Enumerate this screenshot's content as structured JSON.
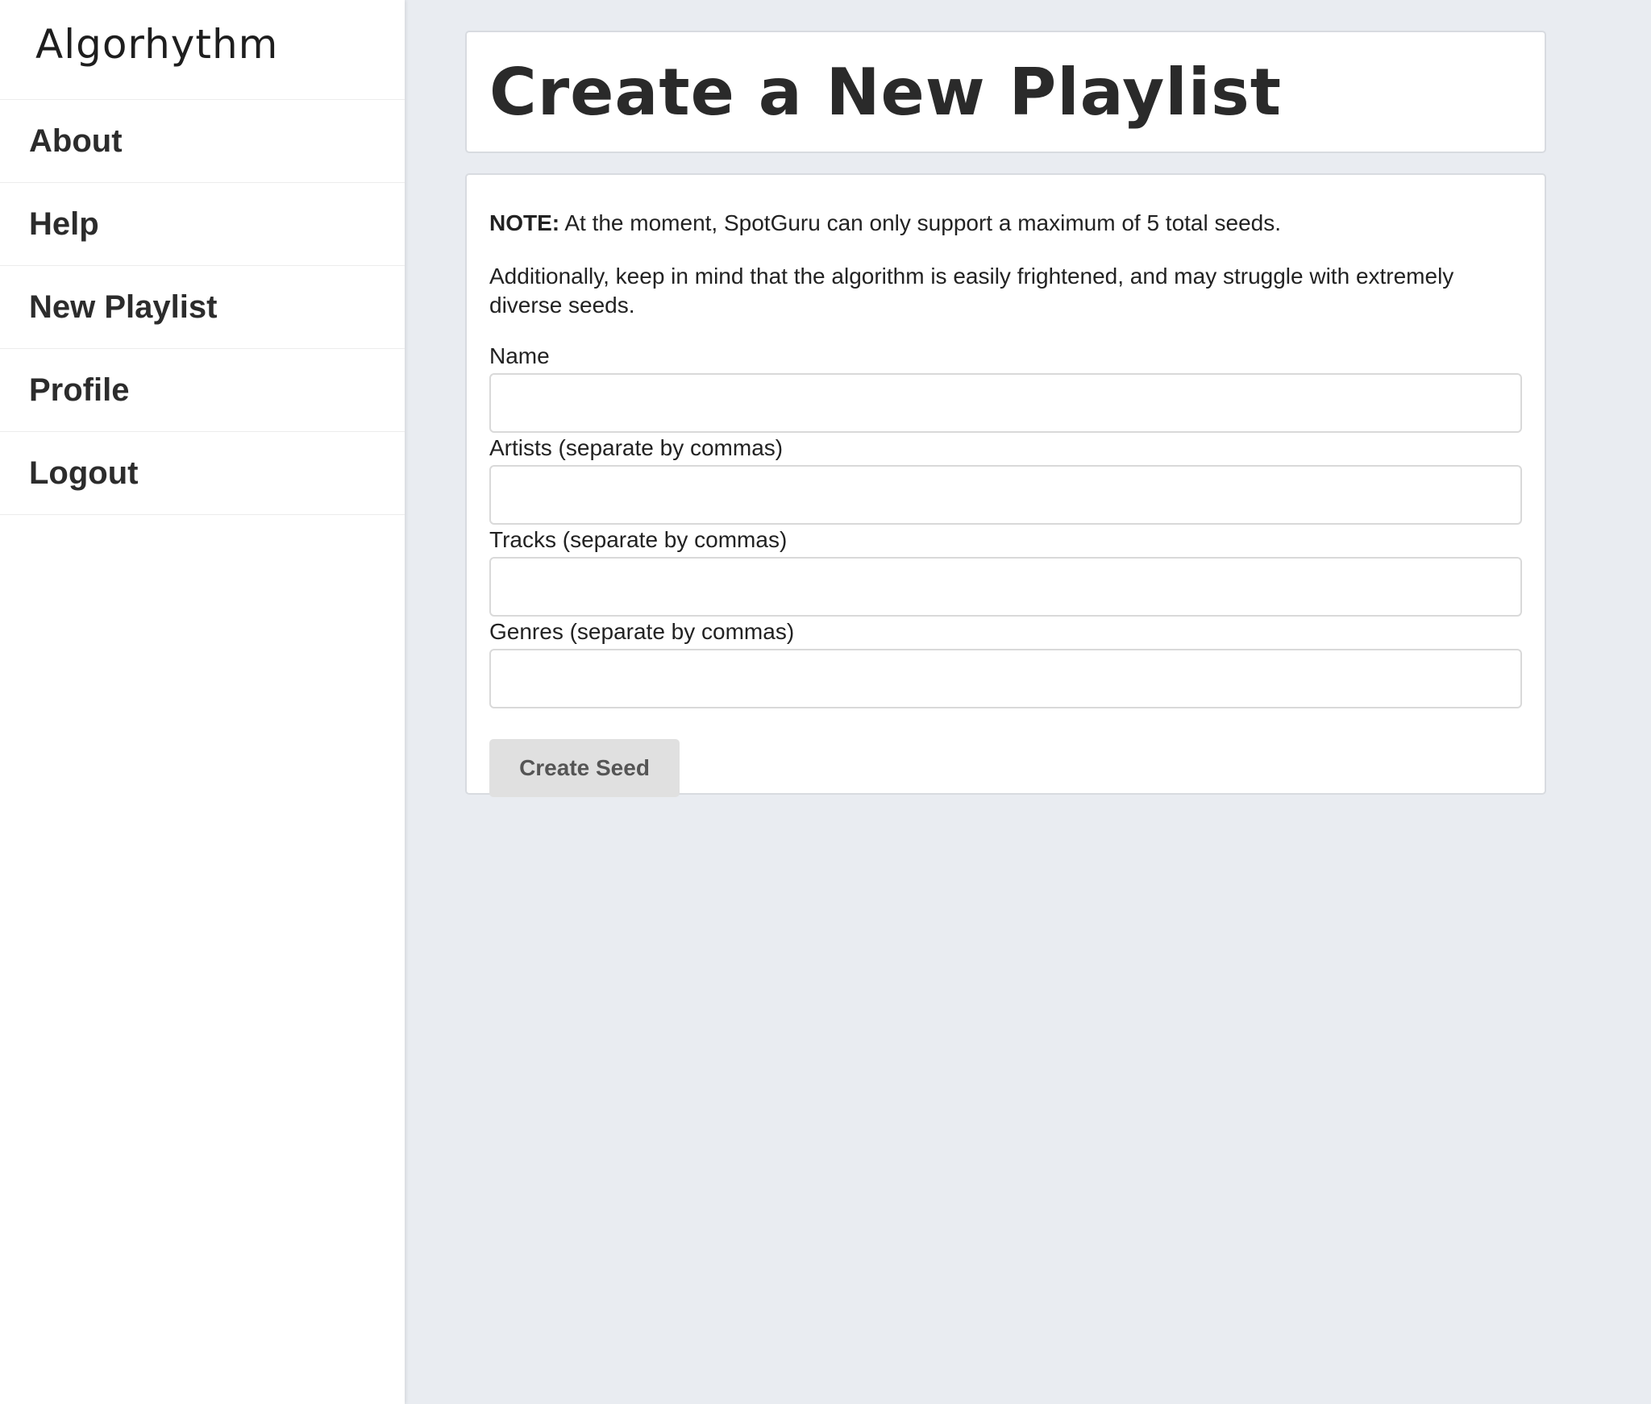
{
  "sidebar": {
    "brand": "Algorhythm",
    "items": [
      {
        "label": "About"
      },
      {
        "label": "Help"
      },
      {
        "label": "New Playlist"
      },
      {
        "label": "Profile"
      },
      {
        "label": "Logout"
      }
    ]
  },
  "main": {
    "title": "Create a New Playlist",
    "note_label": "NOTE:",
    "note_text": " At the moment, SpotGuru can only support a maximum of 5 total seeds.",
    "paragraph": "Additionally, keep in mind that the algorithm is easily frightened, and may struggle with extremely diverse seeds.",
    "fields": [
      {
        "label": "Name",
        "value": "",
        "placeholder": ""
      },
      {
        "label": "Artists (separate by commas)",
        "value": "",
        "placeholder": ""
      },
      {
        "label": "Tracks (separate by commas)",
        "value": "",
        "placeholder": ""
      },
      {
        "label": "Genres (separate by commas)",
        "value": "",
        "placeholder": ""
      }
    ],
    "submit_label": "Create Seed"
  },
  "colors": {
    "background": "#e9ecf1",
    "sidebar": "#ffffff",
    "button": "#e0e0e0"
  }
}
